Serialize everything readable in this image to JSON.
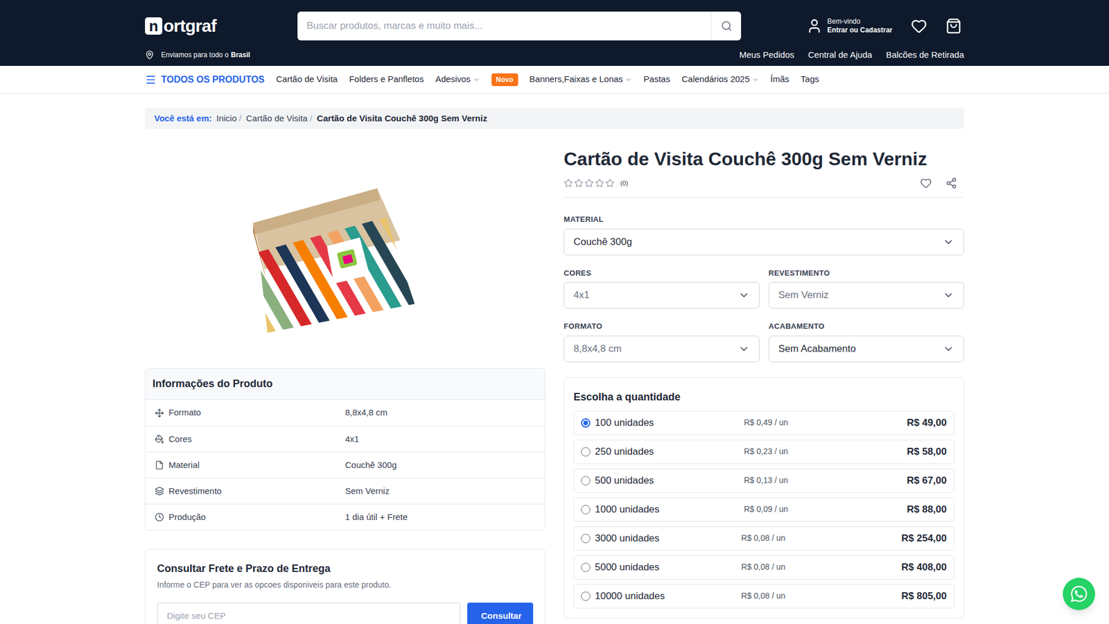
{
  "header": {
    "logo": {
      "mark": "n",
      "text": "ortgraf"
    },
    "shipping": {
      "prefix": "Enviamos para todo o",
      "bold": "Brasil"
    },
    "search": {
      "placeholder": "Buscar produtos, marcas e muito mais..."
    },
    "account": {
      "greeting": "Bem-vindo",
      "action": "Entrar ou Cadastrar"
    },
    "links": [
      "Meus Pedidos",
      "Central de Ajuda",
      "Balcões de Retirada"
    ]
  },
  "nav": {
    "all_products": "TODOS OS PRODUTOS",
    "items": [
      {
        "label": "Cartão de Visita",
        "kind": "link",
        "dropdown": false
      },
      {
        "label": "Folders e Panfletos",
        "kind": "link",
        "dropdown": false
      },
      {
        "label": "Adesivos",
        "kind": "link",
        "dropdown": true
      },
      {
        "label": "Novo",
        "kind": "badge",
        "dropdown": false
      },
      {
        "label": "Banners,Faixas e Lonas",
        "kind": "link",
        "dropdown": true
      },
      {
        "label": "Pastas",
        "kind": "link",
        "dropdown": false
      },
      {
        "label": "Calendários 2025",
        "kind": "link",
        "dropdown": true
      },
      {
        "label": "Ímãs",
        "kind": "link",
        "dropdown": false
      },
      {
        "label": "Tags",
        "kind": "link",
        "dropdown": false
      }
    ]
  },
  "breadcrumb": {
    "label": "Você está em:",
    "separator": "/",
    "items": [
      {
        "label": "Inicio",
        "current": false
      },
      {
        "label": "Cartão de Visita",
        "current": false
      },
      {
        "label": "Cartão de Visita Couchê 300g Sem Verniz",
        "current": true
      }
    ]
  },
  "product": {
    "title": "Cartão de Visita Couchê 300g Sem Verniz",
    "stars": 0,
    "rating_count": "(0)"
  },
  "options": {
    "material": {
      "label": "MATERIAL",
      "value": "Couchê 300g",
      "disabled": false
    },
    "pairs": [
      {
        "label": "CORES",
        "value": "4x1",
        "disabled": true
      },
      {
        "label": "REVESTIMENTO",
        "value": "Sem Verniz",
        "disabled": true
      },
      {
        "label": "FORMATO",
        "value": "8,8x4,8 cm",
        "disabled": true
      },
      {
        "label": "ACABAMENTO",
        "value": "Sem Acabamento",
        "disabled": false
      }
    ]
  },
  "info": {
    "title": "Informações do Produto",
    "rows": [
      {
        "label": "Formato",
        "value": "8,8x4,8 cm",
        "kind": "format"
      },
      {
        "label": "Cores",
        "value": "4x1",
        "kind": "colors"
      },
      {
        "label": "Material",
        "value": "Couchê 300g",
        "kind": "material"
      },
      {
        "label": "Revestimento",
        "value": "Sem Verniz",
        "kind": "coating"
      },
      {
        "label": "Produção",
        "value": "1 dia útil + Frete",
        "kind": "production"
      }
    ]
  },
  "quantity": {
    "title": "Escolha a quantidade",
    "options": [
      {
        "label": "100 unidades",
        "unit": "R$ 0,49 / un",
        "total": "R$ 49,00",
        "selected": true
      },
      {
        "label": "250 unidades",
        "unit": "R$ 0,23 / un",
        "total": "R$ 58,00",
        "selected": false
      },
      {
        "label": "500 unidades",
        "unit": "R$ 0,13 / un",
        "total": "R$ 67,00",
        "selected": false
      },
      {
        "label": "1000 unidades",
        "unit": "R$ 0,09 / un",
        "total": "R$ 88,00",
        "selected": false
      },
      {
        "label": "3000 unidades",
        "unit": "R$ 0,08 / un",
        "total": "R$ 254,00",
        "selected": false
      },
      {
        "label": "5000 unidades",
        "unit": "R$ 0,08 / un",
        "total": "R$ 408,00",
        "selected": false
      },
      {
        "label": "10000 unidades",
        "unit": "R$ 0,08 / un",
        "total": "R$ 805,00",
        "selected": false
      }
    ]
  },
  "shipping_calc": {
    "title": "Consultar Frete e Prazo de Entrega",
    "description": "Informe o CEP para ver as opcoes disponiveis para este produto.",
    "placeholder": "Digite seu CEP",
    "button": "Consultar"
  }
}
